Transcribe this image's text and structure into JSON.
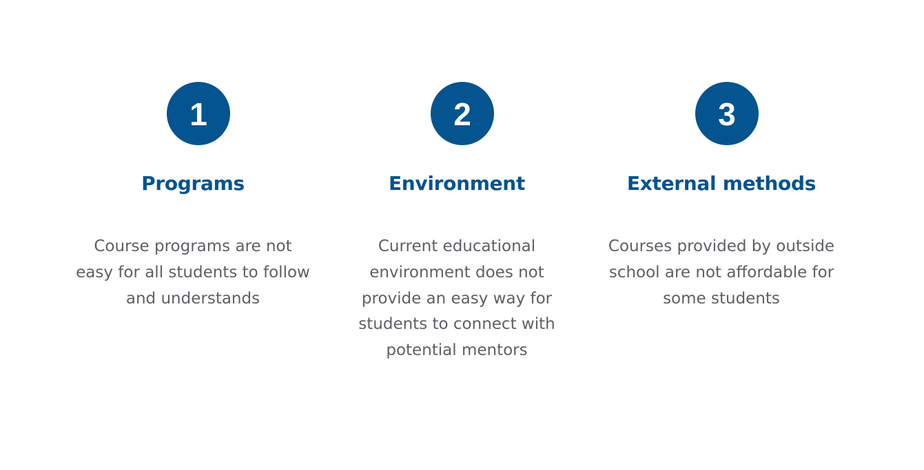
{
  "colors": {
    "accent": "#04548f",
    "body_text": "#5f6066",
    "background": "#ffffff"
  },
  "features": [
    {
      "number": "1",
      "title": "Programs",
      "description": "Course programs are not easy for all students to follow and understands"
    },
    {
      "number": "2",
      "title": "Environment",
      "description": "Current educational environment does not provide an easy way for students to connect with potential mentors"
    },
    {
      "number": "3",
      "title": "External methods",
      "description": "Courses provided by outside school are not affordable for some students"
    }
  ]
}
